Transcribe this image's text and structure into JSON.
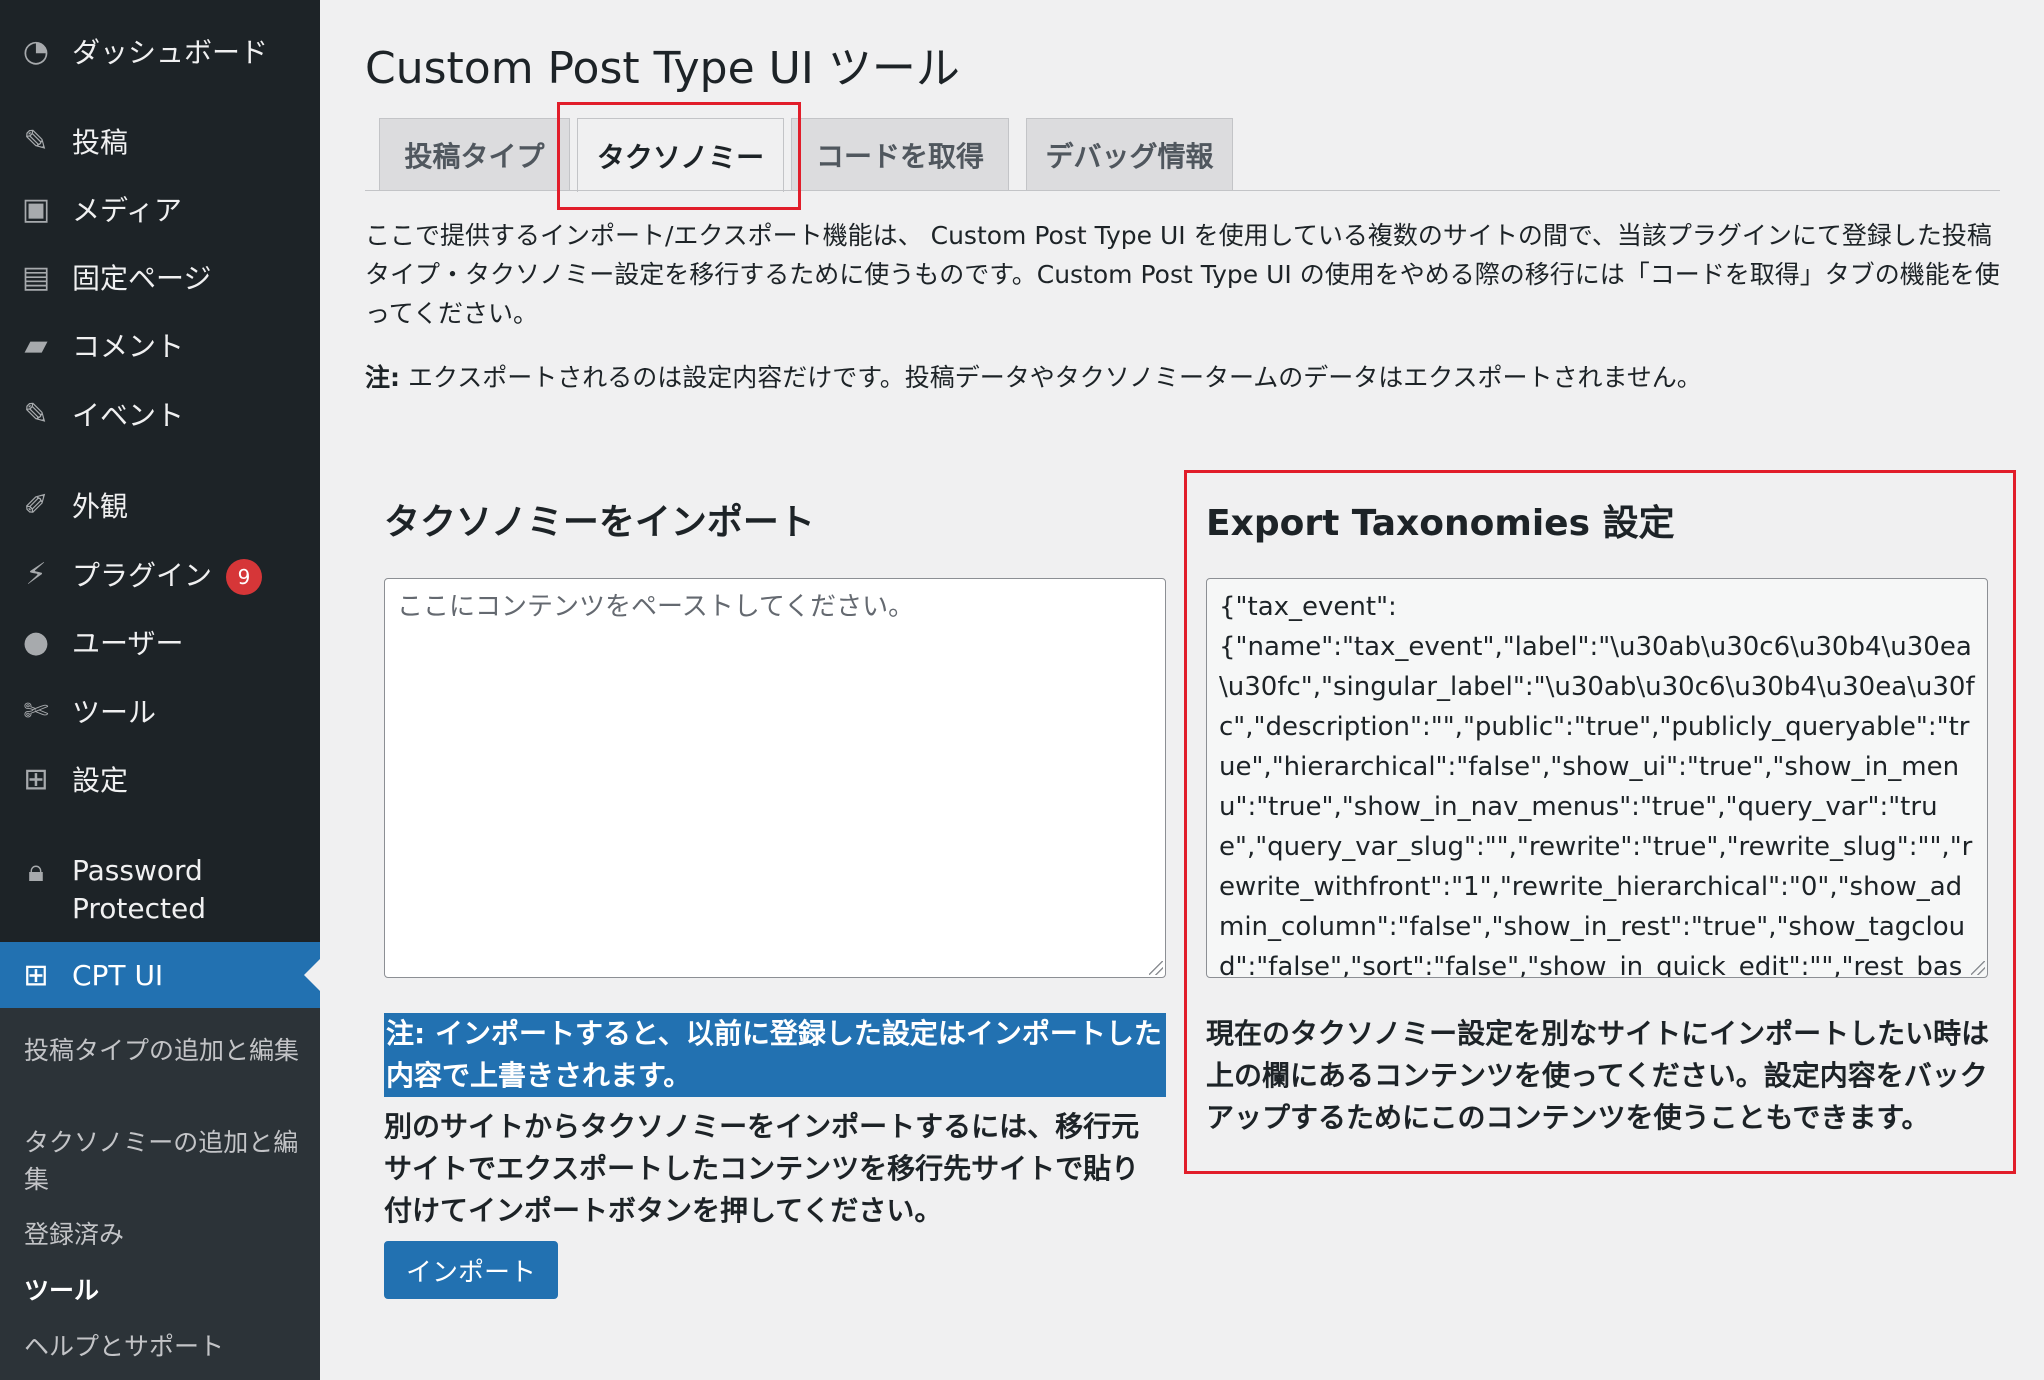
{
  "sidebar": {
    "items": [
      {
        "label": "ダッシュボード",
        "icon": "dashboard-icon"
      },
      {
        "label": "投稿",
        "icon": "pin-icon"
      },
      {
        "label": "メディア",
        "icon": "media-icon"
      },
      {
        "label": "固定ページ",
        "icon": "page-icon"
      },
      {
        "label": "コメント",
        "icon": "comment-icon"
      },
      {
        "label": "イベント",
        "icon": "pin-icon"
      },
      {
        "label": "外観",
        "icon": "brush-icon"
      },
      {
        "label": "プラグイン",
        "icon": "plugin-icon",
        "badge": "9"
      },
      {
        "label": "ユーザー",
        "icon": "user-icon"
      },
      {
        "label": "ツール",
        "icon": "wrench-icon"
      },
      {
        "label": "設定",
        "icon": "settings-icon"
      },
      {
        "label": "Password\nProtected",
        "icon": "lock-icon"
      },
      {
        "label": "CPT UI",
        "icon": "grid-icon"
      }
    ],
    "submenu": [
      "投稿タイプの追加と編集",
      "タクソノミーの追加と編集",
      "登録済み",
      "ツール",
      "ヘルプとサポート"
    ]
  },
  "page": {
    "title": "Custom Post Type UI ツール",
    "tabs": [
      "投稿タイプ",
      "タクソノミー",
      "コードを取得",
      "デバッグ情報"
    ],
    "active_tab": "タクソノミー",
    "intro": "ここで提供するインポート/エクスポート機能は、 Custom Post Type UI を使用している複数のサイトの間で、当該プラグインにて登録した投稿タイプ・タクソノミー設定を移行するために使うものです。Custom Post Type UI の使用をやめる際の移行には「コードを取得」タブの機能を使ってください。",
    "note_label": "注:",
    "note_text": " エクスポートされるのは設定内容だけです。投稿データやタクソノミータームのデータはエクスポートされません。"
  },
  "import": {
    "title": "タクソノミーをインポート",
    "placeholder": "ここにコンテンツをペーストしてください。",
    "warning_label": "注:",
    "warning_text": " インポートすると、以前に登録した設定はインポートした内容で上書きされます。",
    "description": "別のサイトからタクソノミーをインポートするには、移行元サイトでエクスポートしたコンテンツを移行先サイトで貼り付けてインポートボタンを押してください。",
    "button_label": "インポート"
  },
  "export": {
    "title": "Export Taxonomies 設定",
    "content": "{\"tax_event\":\n{\"name\":\"tax_event\",\"label\":\"\\u30ab\\u30c6\\u30b4\\u30ea\\u30fc\",\"singular_label\":\"\\u30ab\\u30c6\\u30b4\\u30ea\\u30fc\",\"description\":\"\",\"public\":\"true\",\"publicly_queryable\":\"true\",\"hierarchical\":\"false\",\"show_ui\":\"true\",\"show_in_menu\":\"true\",\"show_in_nav_menus\":\"true\",\"query_var\":\"true\",\"query_var_slug\":\"\",\"rewrite\":\"true\",\"rewrite_slug\":\"\",\"rewrite_withfront\":\"1\",\"rewrite_hierarchical\":\"0\",\"show_admin_column\":\"false\",\"show_in_rest\":\"true\",\"show_tagcloud\":\"false\",\"sort\":\"false\",\"show_in_quick_edit\":\"\",\"rest_base\":\"\",",
    "description": "現在のタクソノミー設定を別なサイトにインポートしたい時は上の欄にあるコンテンツを使ってください。設定内容をバックアップするためにこのコンテンツを使うこともできます。"
  },
  "colors": {
    "sidebar_bg": "#1d2327",
    "accent": "#2271b1",
    "highlight": "#e11d2a",
    "badge": "#d63638"
  }
}
